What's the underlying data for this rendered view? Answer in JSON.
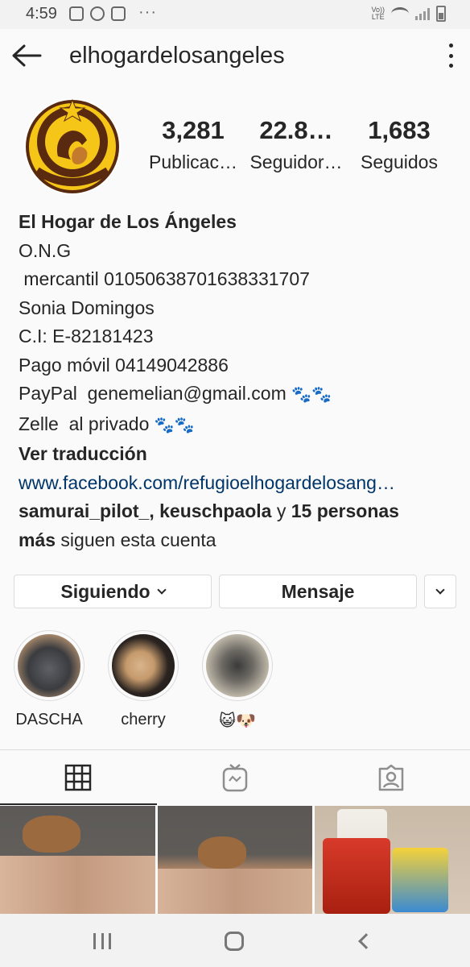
{
  "status_bar": {
    "time": "4:59",
    "more": "···",
    "network": "Vo)) LTE"
  },
  "header": {
    "username": "elhogardelosangeles"
  },
  "profile": {
    "avatar_alt": "El Hogar de Los Ángeles logo",
    "stats": [
      {
        "value": "3,281",
        "label": "Publicac…"
      },
      {
        "value": "22.8…",
        "label": "Seguidor…"
      },
      {
        "value": "1,683",
        "label": "Seguidos"
      }
    ]
  },
  "bio": {
    "name": "El Hogar de Los Ángeles",
    "lines": [
      "O.N.G",
      " mercantil 01050638701638331707",
      "Sonia Domingos",
      "C.I: E-82181423",
      "Pago móvil 04149042886",
      "PayPal  genemelian@gmail.com",
      "Zelle  al privado"
    ],
    "paws": "🐾🐾",
    "translate": "Ver traducción",
    "link": "www.facebook.com/refugioelhogardelosang…",
    "followed_by": {
      "users": "samurai_pilot_, keuschpaola",
      "connector": " y ",
      "count": "15 personas",
      "more": "más",
      "suffix": " siguen esta cuenta"
    }
  },
  "actions": {
    "following": "Siguiendo",
    "message": "Mensaje"
  },
  "highlights": [
    {
      "label": "DASCHA"
    },
    {
      "label": "cherry"
    },
    {
      "label": "😺🐶"
    }
  ],
  "tabs": [
    {
      "name": "grid-icon"
    },
    {
      "name": "igtv-icon"
    },
    {
      "name": "tagged-icon"
    }
  ],
  "colors": {
    "text": "#262626",
    "link": "#003569",
    "border": "#dbdbdb",
    "logo_brown": "#5a2a10",
    "logo_yellow": "#f5c518"
  }
}
